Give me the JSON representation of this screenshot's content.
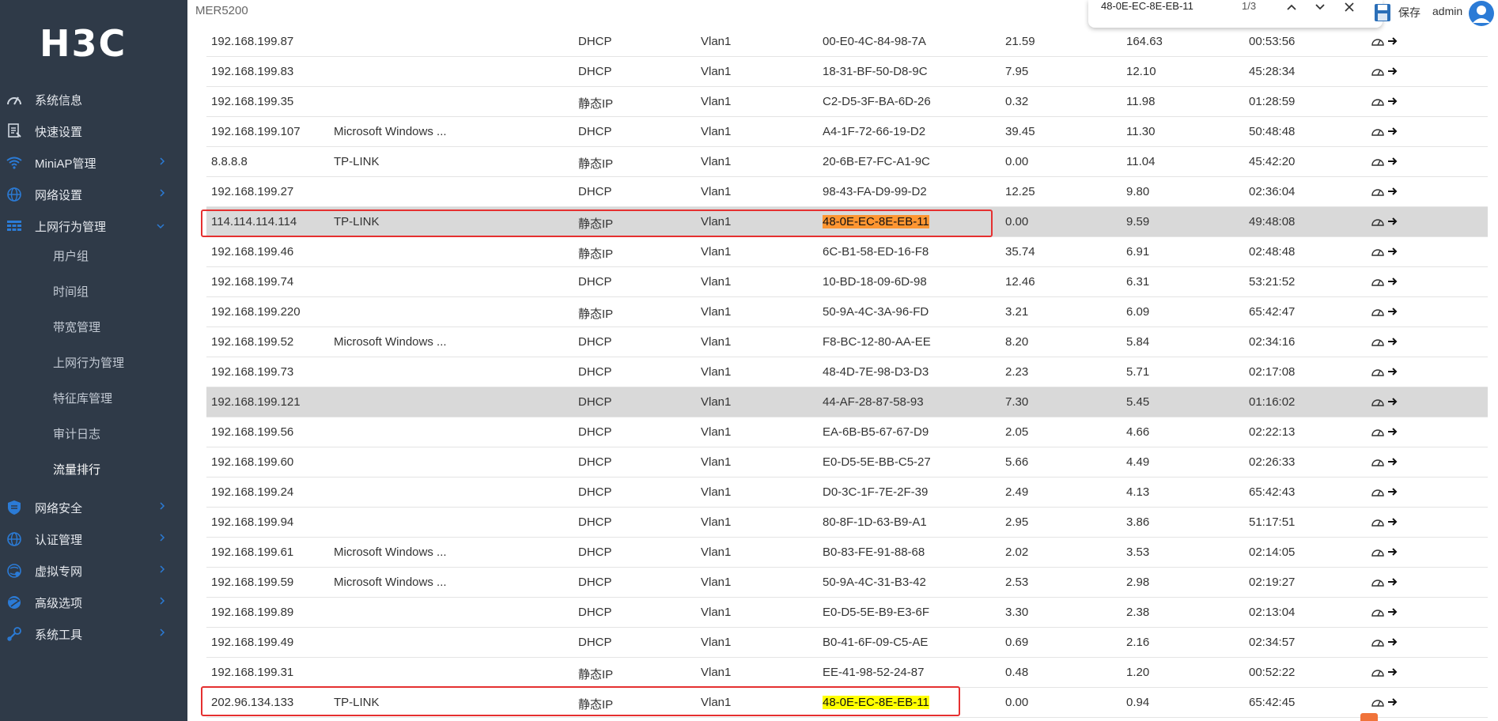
{
  "brand": {
    "logo": "H3C",
    "model": "MER5200"
  },
  "header": {
    "save_label": "保存",
    "user": "admin"
  },
  "find": {
    "query": "48-0E-EC-8E-EB-11",
    "count": "1/3"
  },
  "sidebar": {
    "items": [
      {
        "label": "系统信息",
        "icon": "gauge-icon",
        "has_children": false
      },
      {
        "label": "快速设置",
        "icon": "document-icon",
        "has_children": false
      },
      {
        "label": "MiniAP管理",
        "icon": "wifi-icon",
        "has_children": true
      },
      {
        "label": "网络设置",
        "icon": "globe-icon",
        "has_children": true
      },
      {
        "label": "上网行为管理",
        "icon": "behavior-grid-icon",
        "has_children": true,
        "expanded": true
      },
      {
        "label": "网络安全",
        "icon": "shield-icon",
        "has_children": true
      },
      {
        "label": "认证管理",
        "icon": "globe-icon",
        "has_children": true
      },
      {
        "label": "虚拟专网",
        "icon": "vpn-globe-icon",
        "has_children": true
      },
      {
        "label": "高级选项",
        "icon": "advanced-globe-icon",
        "has_children": true
      },
      {
        "label": "系统工具",
        "icon": "wrench-icon",
        "has_children": true
      }
    ],
    "subitems": [
      "用户组",
      "时间组",
      "带宽管理",
      "上网行为管理",
      "特征库管理",
      "审计日志",
      "流量排行"
    ],
    "active_subitem": "流量排行"
  },
  "table": {
    "rows": [
      {
        "ip": "192.168.199.87",
        "host": "",
        "type": "DHCP",
        "vlan": "Vlan1",
        "mac": "00-E0-4C-84-98-7A",
        "up": "21.59",
        "down": "164.63",
        "time": "00:53:56"
      },
      {
        "ip": "192.168.199.83",
        "host": "",
        "type": "DHCP",
        "vlan": "Vlan1",
        "mac": "18-31-BF-50-D8-9C",
        "up": "7.95",
        "down": "12.10",
        "time": "45:28:34"
      },
      {
        "ip": "192.168.199.35",
        "host": "",
        "type": "静态IP",
        "vlan": "Vlan1",
        "mac": "C2-D5-3F-BA-6D-26",
        "up": "0.32",
        "down": "11.98",
        "time": "01:28:59"
      },
      {
        "ip": "192.168.199.107",
        "host": "Microsoft Windows ...",
        "type": "DHCP",
        "vlan": "Vlan1",
        "mac": "A4-1F-72-66-19-D2",
        "up": "39.45",
        "down": "11.30",
        "time": "50:48:48"
      },
      {
        "ip": "8.8.8.8",
        "host": "TP-LINK",
        "type": "静态IP",
        "vlan": "Vlan1",
        "mac": "20-6B-E7-FC-A1-9C",
        "up": "0.00",
        "down": "11.04",
        "time": "45:42:20"
      },
      {
        "ip": "192.168.199.27",
        "host": "",
        "type": "DHCP",
        "vlan": "Vlan1",
        "mac": "98-43-FA-D9-99-D2",
        "up": "12.25",
        "down": "9.80",
        "time": "02:36:04"
      },
      {
        "ip": "114.114.114.114",
        "host": "TP-LINK",
        "type": "静态IP",
        "vlan": "Vlan1",
        "mac": "48-0E-EC-8E-EB-11",
        "up": "0.00",
        "down": "9.59",
        "time": "49:48:08",
        "highlight": true,
        "mac_mark": "current",
        "boxed": true
      },
      {
        "ip": "192.168.199.46",
        "host": "",
        "type": "静态IP",
        "vlan": "Vlan1",
        "mac": "6C-B1-58-ED-16-F8",
        "up": "35.74",
        "down": "6.91",
        "time": "02:48:48"
      },
      {
        "ip": "192.168.199.74",
        "host": "",
        "type": "DHCP",
        "vlan": "Vlan1",
        "mac": "10-BD-18-09-6D-98",
        "up": "12.46",
        "down": "6.31",
        "time": "53:21:52"
      },
      {
        "ip": "192.168.199.220",
        "host": "",
        "type": "静态IP",
        "vlan": "Vlan1",
        "mac": "50-9A-4C-3A-96-FD",
        "up": "3.21",
        "down": "6.09",
        "time": "65:42:47"
      },
      {
        "ip": "192.168.199.52",
        "host": "Microsoft Windows ...",
        "type": "DHCP",
        "vlan": "Vlan1",
        "mac": "F8-BC-12-80-AA-EE",
        "up": "8.20",
        "down": "5.84",
        "time": "02:34:16"
      },
      {
        "ip": "192.168.199.73",
        "host": "",
        "type": "DHCP",
        "vlan": "Vlan1",
        "mac": "48-4D-7E-98-D3-D3",
        "up": "2.23",
        "down": "5.71",
        "time": "02:17:08"
      },
      {
        "ip": "192.168.199.121",
        "host": "",
        "type": "DHCP",
        "vlan": "Vlan1",
        "mac": "44-AF-28-87-58-93",
        "up": "7.30",
        "down": "5.45",
        "time": "01:16:02",
        "highlight": true
      },
      {
        "ip": "192.168.199.56",
        "host": "",
        "type": "DHCP",
        "vlan": "Vlan1",
        "mac": "EA-6B-B5-67-67-D9",
        "up": "2.05",
        "down": "4.66",
        "time": "02:22:13"
      },
      {
        "ip": "192.168.199.60",
        "host": "",
        "type": "DHCP",
        "vlan": "Vlan1",
        "mac": "E0-D5-5E-BB-C5-27",
        "up": "5.66",
        "down": "4.49",
        "time": "02:26:33"
      },
      {
        "ip": "192.168.199.24",
        "host": "",
        "type": "DHCP",
        "vlan": "Vlan1",
        "mac": "D0-3C-1F-7E-2F-39",
        "up": "2.49",
        "down": "4.13",
        "time": "65:42:43"
      },
      {
        "ip": "192.168.199.94",
        "host": "",
        "type": "DHCP",
        "vlan": "Vlan1",
        "mac": "80-8F-1D-63-B9-A1",
        "up": "2.95",
        "down": "3.86",
        "time": "51:17:51"
      },
      {
        "ip": "192.168.199.61",
        "host": "Microsoft Windows ...",
        "type": "DHCP",
        "vlan": "Vlan1",
        "mac": "B0-83-FE-91-88-68",
        "up": "2.02",
        "down": "3.53",
        "time": "02:14:05"
      },
      {
        "ip": "192.168.199.59",
        "host": "Microsoft Windows ...",
        "type": "DHCP",
        "vlan": "Vlan1",
        "mac": "50-9A-4C-31-B3-42",
        "up": "2.53",
        "down": "2.98",
        "time": "02:19:27"
      },
      {
        "ip": "192.168.199.89",
        "host": "",
        "type": "DHCP",
        "vlan": "Vlan1",
        "mac": "E0-D5-5E-B9-E3-6F",
        "up": "3.30",
        "down": "2.38",
        "time": "02:13:04"
      },
      {
        "ip": "192.168.199.49",
        "host": "",
        "type": "DHCP",
        "vlan": "Vlan1",
        "mac": "B0-41-6F-09-C5-AE",
        "up": "0.69",
        "down": "2.16",
        "time": "02:34:57"
      },
      {
        "ip": "192.168.199.31",
        "host": "",
        "type": "静态IP",
        "vlan": "Vlan1",
        "mac": "EE-41-98-52-24-87",
        "up": "0.48",
        "down": "1.20",
        "time": "00:52:22"
      },
      {
        "ip": "202.96.134.133",
        "host": "TP-LINK",
        "type": "静态IP",
        "vlan": "Vlan1",
        "mac": "48-0E-EC-8E-EB-11",
        "up": "0.00",
        "down": "0.94",
        "time": "65:42:45",
        "mac_mark": "match",
        "boxed": true
      }
    ]
  },
  "colors": {
    "sidebar_bg": "#2f3a48",
    "row_highlight": "#d9d9d9",
    "mark_current": "#ff9632",
    "mark_match": "#ffff00",
    "annotation_box": "#e53030",
    "accent_blue": "#2b7bd6"
  }
}
